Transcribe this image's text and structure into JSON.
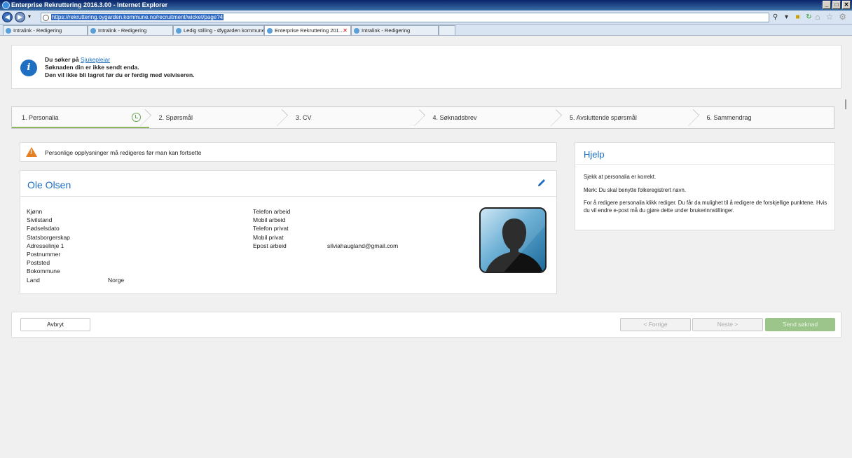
{
  "browser": {
    "title": "Enterprise Rekruttering 2016.3.00 - Internet Explorer",
    "url": "https://rekruttering.oygarden.kommune.no/recruitment/wicket/page?4",
    "window_buttons": [
      "_",
      "□",
      "✕"
    ],
    "tabs": [
      {
        "label": "Intralink - Redigering"
      },
      {
        "label": "Intralink - Redigering"
      },
      {
        "label": "Ledig stilling - Øygarden kommune"
      },
      {
        "label": "Enterprise Rekruttering 201…"
      },
      {
        "label": "Intralink - Redigering"
      }
    ]
  },
  "notice": {
    "line1_prefix": "Du søker på ",
    "line1_link": "Sjukepleiar",
    "line2": "Søknaden din er ikke sendt enda.",
    "line3": "Den vil ikke bli lagret før du er ferdig med veiviseren."
  },
  "steps": [
    {
      "label": "1. Personalia"
    },
    {
      "label": "2. Spørsmål"
    },
    {
      "label": "3. CV"
    },
    {
      "label": "4. Søknadsbrev"
    },
    {
      "label": "5. Avsluttende spørsmål"
    },
    {
      "label": "6. Sammendrag"
    }
  ],
  "warning": {
    "text": "Personlige opplysninger må redigeres før man kan fortsette"
  },
  "person": {
    "name": "Ole Olsen",
    "left_fields": [
      {
        "label": "Kjønn",
        "value": ""
      },
      {
        "label": "Sivilstand",
        "value": ""
      },
      {
        "label": "Fødselsdato",
        "value": ""
      },
      {
        "label": "Statsborgerskap",
        "value": ""
      },
      {
        "label": "Adresselinje 1",
        "value": ""
      },
      {
        "label": "Postnummer",
        "value": ""
      },
      {
        "label": "Poststed",
        "value": ""
      },
      {
        "label": "Bokommune",
        "value": ""
      },
      {
        "label": "Land",
        "value": "Norge"
      }
    ],
    "right_fields": [
      {
        "label": "Telefon arbeid",
        "value": ""
      },
      {
        "label": "Mobil arbeid",
        "value": ""
      },
      {
        "label": "Telefon privat",
        "value": ""
      },
      {
        "label": "Mobil privat",
        "value": ""
      },
      {
        "label": "Epost arbeid",
        "value": "silviahaugland@gmail.com"
      }
    ]
  },
  "help": {
    "title": "Hjelp",
    "paragraphs": [
      "Sjekk at personalia er korrekt.",
      "Merk: Du skal benytte folkeregistrert navn.",
      "For å redigere personalia klikk rediger. Du får da mulighet til å redigere de forskjellige punktene. Hvis du vil endre e-post må du gjøre dette under brukerinnstillinger."
    ]
  },
  "buttons": {
    "cancel": "Avbryt",
    "prev": "< Forrige",
    "next": "Neste >",
    "send": "Send søknad"
  }
}
